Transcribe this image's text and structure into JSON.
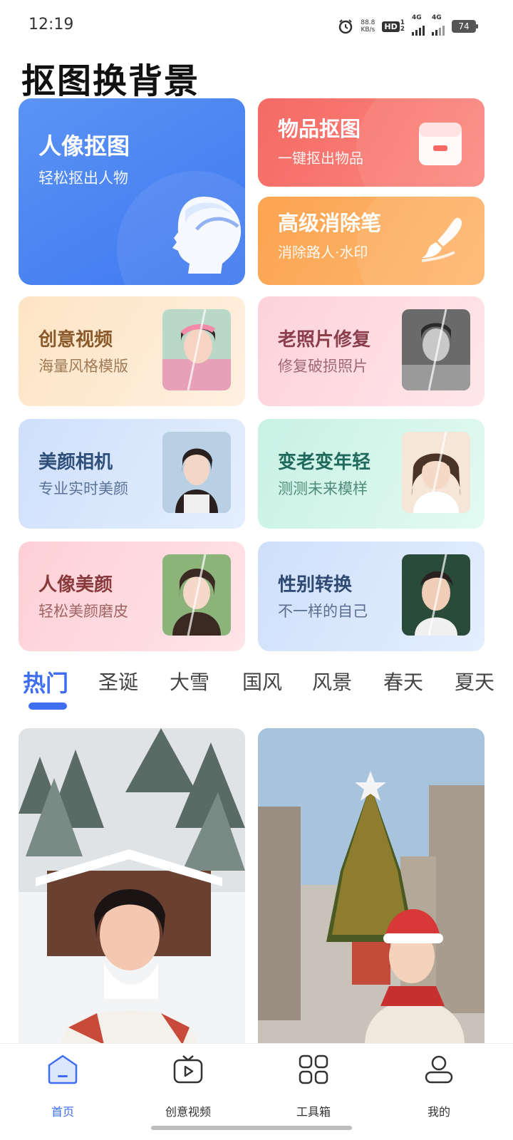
{
  "status_bar": {
    "time": "12:19",
    "speed_value": "88.8",
    "speed_unit": "KB/s",
    "hd_badge": "HD",
    "hd_sim": "1",
    "hd_sim2": "2",
    "signal1_label": "4G",
    "signal2_label": "4G",
    "battery": "74"
  },
  "app_title": "抠图换背景",
  "tools": {
    "portrait": {
      "title": "人像抠图",
      "subtitle": "轻松抠出人物",
      "icon": "head-silhouette-icon",
      "color": "#4a85f2"
    },
    "object": {
      "title": "物品抠图",
      "subtitle": "一键抠出物品",
      "icon": "box-icon",
      "color": "#f56a64"
    },
    "eraser": {
      "title": "高级消除笔",
      "subtitle": "消除路人·水印",
      "icon": "brush-icon",
      "color": "#fca451"
    }
  },
  "features": [
    {
      "title": "创意视频",
      "subtitle": "海量风格模版",
      "title_color": "#8a5a2a",
      "sub_color": "#a07a56"
    },
    {
      "title": "老照片修复",
      "subtitle": "修复破损照片",
      "title_color": "#8a3f4a",
      "sub_color": "#a06870"
    },
    {
      "title": "美颜相机",
      "subtitle": "专业实时美颜",
      "title_color": "#2f4f7a",
      "sub_color": "#5a7298"
    },
    {
      "title": "变老变年轻",
      "subtitle": "测测未来模样",
      "title_color": "#1f6a5a",
      "sub_color": "#4f8a7a"
    },
    {
      "title": "人像美颜",
      "subtitle": "轻松美颜磨皮",
      "title_color": "#8a3a3a",
      "sub_color": "#a06464"
    },
    {
      "title": "性别转换",
      "subtitle": "不一样的自己",
      "title_color": "#2f4a72",
      "sub_color": "#5a6e90"
    }
  ],
  "category_tabs": [
    "热门",
    "圣诞",
    "大雪",
    "国风",
    "风景",
    "春天",
    "夏天"
  ],
  "active_tab": "热门",
  "bottom_nav": [
    {
      "label": "首页",
      "icon": "home-icon",
      "active": true
    },
    {
      "label": "创意视频",
      "icon": "tv-play-icon",
      "active": false
    },
    {
      "label": "工具箱",
      "icon": "grid-icon",
      "active": false
    },
    {
      "label": "我的",
      "icon": "person-icon",
      "active": false
    }
  ],
  "accent_color": "#3f6ef0"
}
